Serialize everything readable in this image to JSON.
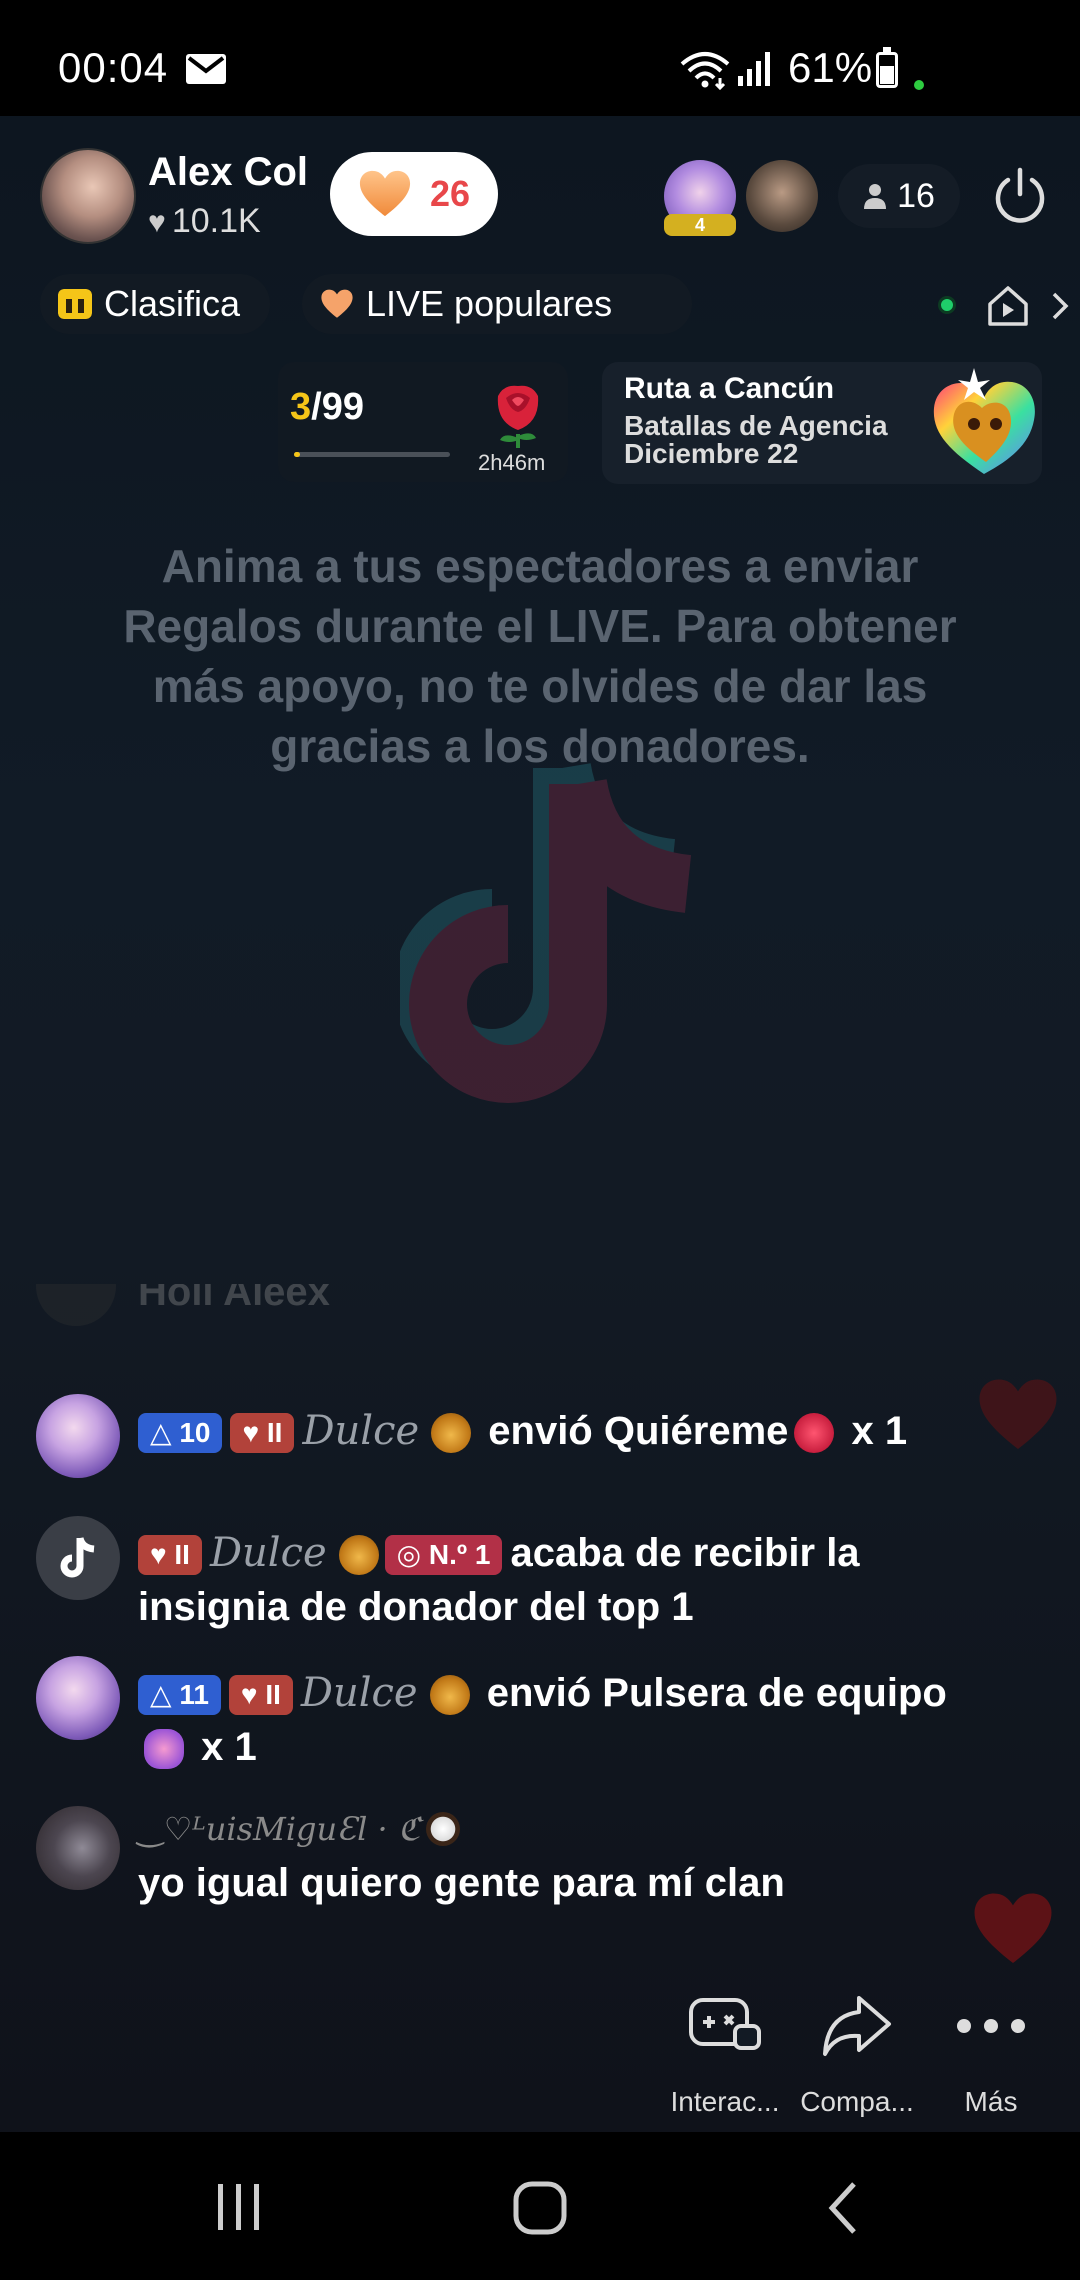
{
  "status_bar": {
    "time": "00:04",
    "battery": "61%"
  },
  "host": {
    "name": "Alex Col",
    "likes": "10.1K",
    "gift_count": "26"
  },
  "viewers": {
    "avatar1_badge": "4",
    "count": "16"
  },
  "chips": {
    "ranking": "Clasifica",
    "popular": "LIVE populares"
  },
  "rank": {
    "current": "3",
    "total": "/99",
    "progress": 0.03,
    "timer": "2h46m"
  },
  "event": {
    "title": "Ruta a Cancún",
    "line1": "Batallas de Agencia",
    "line2": "Diciembre 22"
  },
  "tip": "Anima a tus espectadores a enviar Regalos durante el LIVE. Para obtener más apoyo, no te olvides de dar las gracias a los donadores.",
  "chat": {
    "faded_text": "Holi Aleex",
    "messages": [
      {
        "level": "10",
        "fan_badge": "II",
        "user": "Dulce",
        "text": "envió Quiéreme",
        "qty": "x 1"
      },
      {
        "fan_badge": "II",
        "user": "Dulce",
        "rank_badge": "N.º 1",
        "text": "acaba de recibir la insignia de donador del top 1"
      },
      {
        "level": "11",
        "fan_badge": "II",
        "user": "Dulce",
        "text": "envió Pulsera de equipo",
        "qty": "x 1"
      },
      {
        "user": "‿♡ᴸuisMiguƐl · ℭ",
        "text": "yo igual quiero gente para mí clan"
      }
    ]
  },
  "actions": {
    "interact": "Interac...",
    "share": "Compa...",
    "more": "Más"
  },
  "colors": {
    "accent_yellow": "#f5c518",
    "gift_red": "#e8474a",
    "level_blue": "#2f5fd1",
    "fan_orange": "#b2423a"
  }
}
